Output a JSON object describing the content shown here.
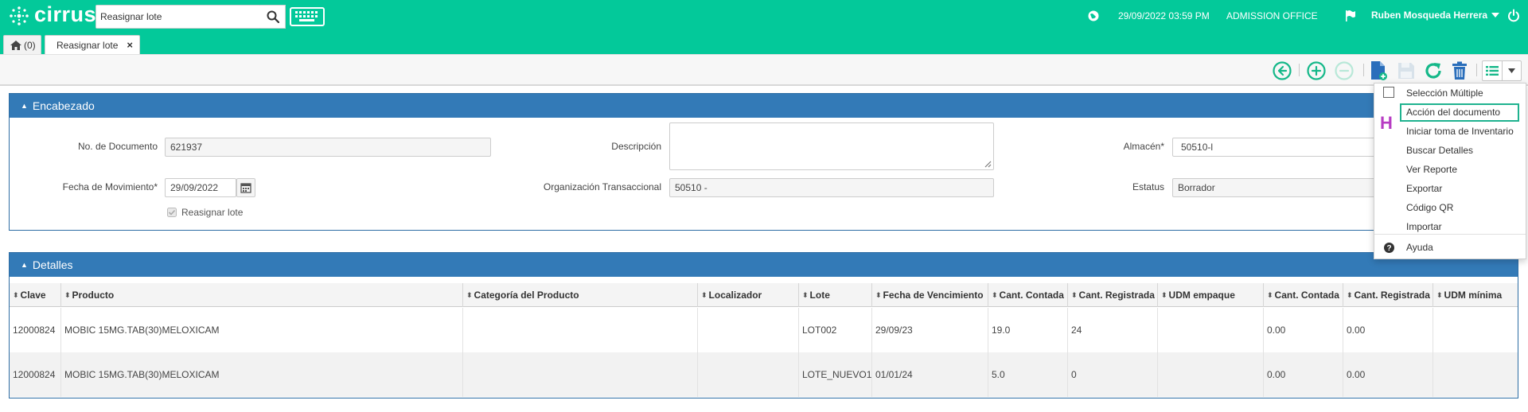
{
  "app": {
    "brand": "cirrus"
  },
  "header": {
    "search_value": "Reasignar lote",
    "datetime": "29/09/2022 03:59 PM",
    "office": "ADMISSION OFFICE",
    "user": "Ruben Mosqueda Herrera"
  },
  "tabs": {
    "home_count": "(0)",
    "active": "Reasignar lote",
    "close": "×"
  },
  "encabezado": {
    "title": "Encabezado",
    "doc_label": "No. de Documento",
    "doc_value": "621937",
    "desc_label": "Descripción",
    "desc_value": "",
    "almacen_label": "Almacén*",
    "almacen_value": "50510-l",
    "fecha_label": "Fecha de Movimiento*",
    "fecha_value": "29/09/2022",
    "org_label": "Organización Transaccional",
    "org_value": "50510 -",
    "estatus_label": "Estatus",
    "estatus_value": "Borrador",
    "reasignar_label": "Reasignar lote"
  },
  "detalles": {
    "title": "Detalles",
    "columns": [
      "Clave",
      "Producto",
      "Categoría del Producto",
      "Localizador",
      "Lote",
      "Fecha de Vencimiento",
      "Cant. Contada",
      "Cant. Registrada",
      "UDM empaque",
      "Cant. Contada",
      "Cant. Registrada",
      "UDM mínima"
    ],
    "rows": [
      [
        "12000824",
        "MOBIC 15MG.TAB(30)MELOXICAM",
        "",
        "",
        "LOT002",
        "29/09/23",
        "19.0",
        "24",
        "",
        "0.00",
        "0.00",
        ""
      ],
      [
        "12000824",
        "MOBIC 15MG.TAB(30)MELOXICAM",
        "",
        "",
        "LOTE_NUEVO1",
        "01/01/24",
        "5.0",
        "0",
        "",
        "0.00",
        "0.00",
        ""
      ]
    ]
  },
  "menu": {
    "items": [
      "Selección Múltiple",
      "Acción del documento",
      "Iniciar toma de Inventario",
      "Buscar Detalles",
      "Ver Reporte",
      "Exportar",
      "Código QR",
      "Importar"
    ],
    "help": "Ayuda",
    "side_letter": "H"
  },
  "colors": {
    "topbar": "#03c99a",
    "panel": "#337ab7",
    "accent_icon": "#15b889",
    "doc_icon": "#2a6ebb",
    "trash_icon": "#2a6ebb"
  }
}
